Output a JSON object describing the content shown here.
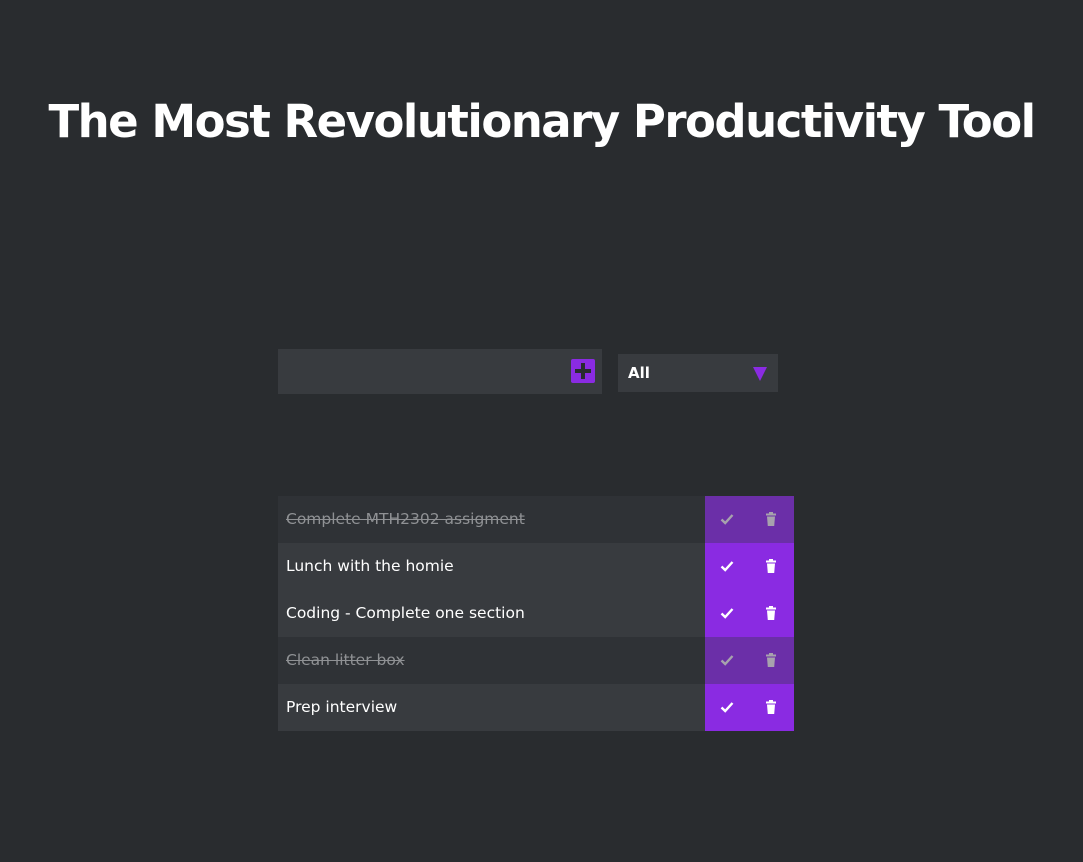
{
  "header": {
    "title": "The Most Revolutionary Productivity Tool"
  },
  "form": {
    "input_value": "",
    "input_placeholder": "",
    "add_icon": "plus-square-icon",
    "filter_selected": "All",
    "filter_icon": "triangle-down-icon"
  },
  "todos": [
    {
      "text": "Complete MTH2302 assigment",
      "completed": true
    },
    {
      "text": "Lunch with the homie",
      "completed": false
    },
    {
      "text": "Coding - Complete one section",
      "completed": false
    },
    {
      "text": "Clean litter box",
      "completed": true
    },
    {
      "text": "Prep interview",
      "completed": false
    }
  ],
  "icons": {
    "complete": "check-icon",
    "delete": "trash-icon"
  },
  "colors": {
    "background": "#292c2f",
    "surface": "#383b3f",
    "accent": "#8a2be2",
    "accent_muted": "#6b2fa8",
    "completed_text": "#8f9194"
  }
}
